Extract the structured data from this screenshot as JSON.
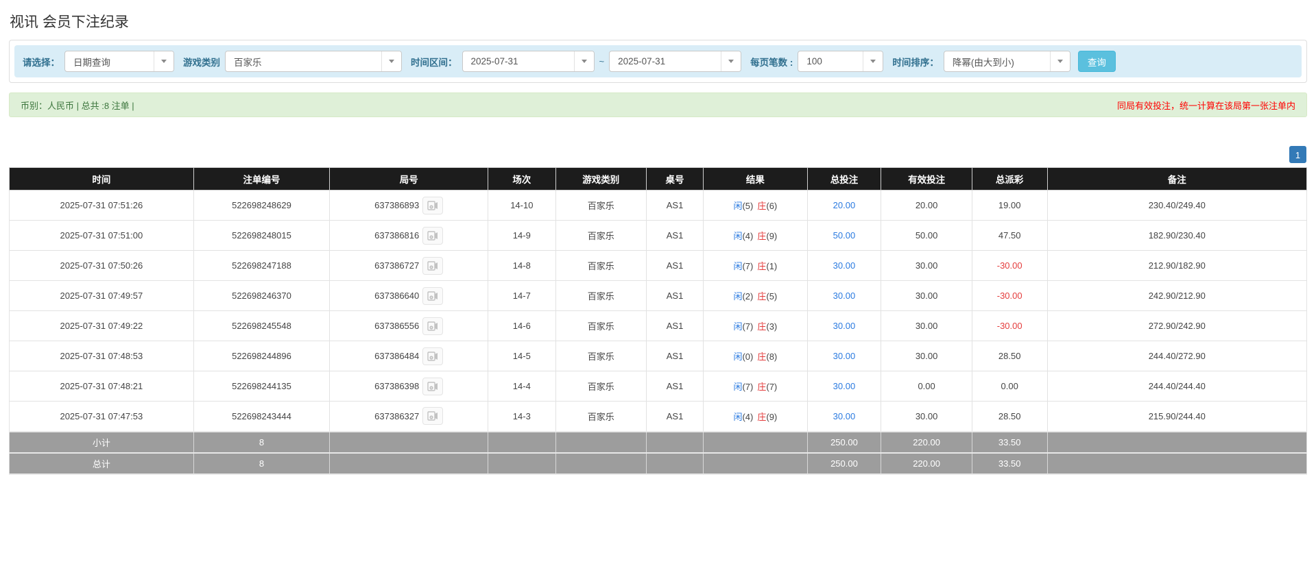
{
  "page": {
    "title": "视讯 会员下注纪录"
  },
  "filters": {
    "select_label": "请选择：",
    "select_value": "日期查询",
    "game_type_label": "游戏类别",
    "game_type_value": "百家乐",
    "time_range_label": "时间区间：",
    "date_from": "2025-07-31",
    "tilde": "~",
    "date_to": "2025-07-31",
    "page_size_label": "每页笔数 :",
    "page_size_value": "100",
    "sort_label": "时间排序：",
    "sort_value": "降幂(由大到小)",
    "search_button": "查询"
  },
  "summary": {
    "left_text": "币别：人民币 | 总共 :8 注单 |",
    "note_text": "同局有效投注，统一计算在该局第一张注单内"
  },
  "pagination": {
    "current_page": "1"
  },
  "table": {
    "headers": [
      "时间",
      "注单编号",
      "局号",
      "场次",
      "游戏类别",
      "桌号",
      "结果",
      "总投注",
      "有效投注",
      "总派彩",
      "备注"
    ],
    "rows": [
      {
        "time": "2025-07-31 07:51:26",
        "bet_id": "522698248629",
        "round_id": "637386893",
        "session": "14-10",
        "game": "百家乐",
        "table_no": "AS1",
        "result_player": "闲",
        "result_player_score": "(5)",
        "result_banker": "庄",
        "result_banker_score": "(6)",
        "total_bet": "20.00",
        "valid_bet": "20.00",
        "payout": "19.00",
        "note": "230.40/249.40"
      },
      {
        "time": "2025-07-31 07:51:00",
        "bet_id": "522698248015",
        "round_id": "637386816",
        "session": "14-9",
        "game": "百家乐",
        "table_no": "AS1",
        "result_player": "闲",
        "result_player_score": "(4)",
        "result_banker": "庄",
        "result_banker_score": "(9)",
        "total_bet": "50.00",
        "valid_bet": "50.00",
        "payout": "47.50",
        "note": "182.90/230.40"
      },
      {
        "time": "2025-07-31 07:50:26",
        "bet_id": "522698247188",
        "round_id": "637386727",
        "session": "14-8",
        "game": "百家乐",
        "table_no": "AS1",
        "result_player": "闲",
        "result_player_score": "(7)",
        "result_banker": "庄",
        "result_banker_score": "(1)",
        "total_bet": "30.00",
        "valid_bet": "30.00",
        "payout": "-30.00",
        "note": "212.90/182.90"
      },
      {
        "time": "2025-07-31 07:49:57",
        "bet_id": "522698246370",
        "round_id": "637386640",
        "session": "14-7",
        "game": "百家乐",
        "table_no": "AS1",
        "result_player": "闲",
        "result_player_score": "(2)",
        "result_banker": "庄",
        "result_banker_score": "(5)",
        "total_bet": "30.00",
        "valid_bet": "30.00",
        "payout": "-30.00",
        "note": "242.90/212.90"
      },
      {
        "time": "2025-07-31 07:49:22",
        "bet_id": "522698245548",
        "round_id": "637386556",
        "session": "14-6",
        "game": "百家乐",
        "table_no": "AS1",
        "result_player": "闲",
        "result_player_score": "(7)",
        "result_banker": "庄",
        "result_banker_score": "(3)",
        "total_bet": "30.00",
        "valid_bet": "30.00",
        "payout": "-30.00",
        "note": "272.90/242.90"
      },
      {
        "time": "2025-07-31 07:48:53",
        "bet_id": "522698244896",
        "round_id": "637386484",
        "session": "14-5",
        "game": "百家乐",
        "table_no": "AS1",
        "result_player": "闲",
        "result_player_score": "(0)",
        "result_banker": "庄",
        "result_banker_score": "(8)",
        "total_bet": "30.00",
        "valid_bet": "30.00",
        "payout": "28.50",
        "note": "244.40/272.90"
      },
      {
        "time": "2025-07-31 07:48:21",
        "bet_id": "522698244135",
        "round_id": "637386398",
        "session": "14-4",
        "game": "百家乐",
        "table_no": "AS1",
        "result_player": "闲",
        "result_player_score": "(7)",
        "result_banker": "庄",
        "result_banker_score": "(7)",
        "total_bet": "30.00",
        "valid_bet": "0.00",
        "payout": "0.00",
        "note": "244.40/244.40"
      },
      {
        "time": "2025-07-31 07:47:53",
        "bet_id": "522698243444",
        "round_id": "637386327",
        "session": "14-3",
        "game": "百家乐",
        "table_no": "AS1",
        "result_player": "闲",
        "result_player_score": "(4)",
        "result_banker": "庄",
        "result_banker_score": "(9)",
        "total_bet": "30.00",
        "valid_bet": "30.00",
        "payout": "28.50",
        "note": "215.90/244.40"
      }
    ],
    "subtotal": {
      "label": "小计",
      "count": "8",
      "total_bet": "250.00",
      "valid_bet": "220.00",
      "payout": "33.50"
    },
    "total": {
      "label": "总计",
      "count": "8",
      "total_bet": "250.00",
      "valid_bet": "220.00",
      "payout": "33.50"
    }
  },
  "icons": {
    "dropdown_arrow": "caret-down-icon",
    "video_replay": "video-film-icon"
  },
  "colors": {
    "filter_bar_bg": "#d9edf7",
    "filter_label": "#31708f",
    "search_button_bg": "#5bc0de",
    "summary_bg": "#dff0d8",
    "summary_text": "#3c763d",
    "note_red": "#ff0000",
    "table_header_bg": "#1c1c1c",
    "total_row_bg": "#9d9d9d",
    "link_blue": "#2a7ae0",
    "negative_red": "#e43b3b",
    "pagination_active_bg": "#337ab7"
  }
}
